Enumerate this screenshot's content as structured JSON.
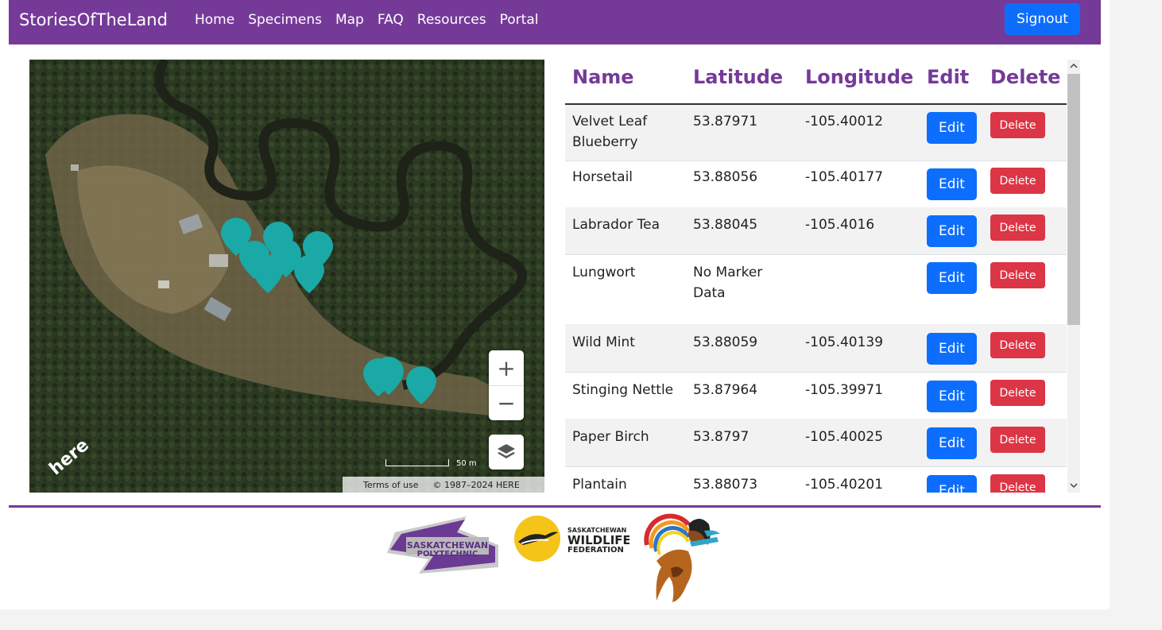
{
  "nav": {
    "brand": "StoriesOfTheLand",
    "links": [
      "Home",
      "Specimens",
      "Map",
      "FAQ",
      "Resources",
      "Portal"
    ],
    "signout": "Signout"
  },
  "map": {
    "terms": "Terms of use",
    "copyright": "© 1987–2024 HERE",
    "scale": "50 m",
    "logo_text": "here",
    "zoom_in": "+",
    "zoom_out": "−",
    "marker_color": "#1aa9a6"
  },
  "table": {
    "headers": [
      "Name",
      "Latitude",
      "Longitude",
      "Edit",
      "Delete"
    ],
    "edit_label": "Edit",
    "delete_label": "Delete",
    "rows": [
      {
        "name": "Velvet Leaf Blueberry",
        "lat": "53.87971",
        "lon": "-105.40012"
      },
      {
        "name": "Horsetail",
        "lat": "53.88056",
        "lon": "-105.40177"
      },
      {
        "name": "Labrador Tea",
        "lat": "53.88045",
        "lon": "-105.4016"
      },
      {
        "name": "Lungwort",
        "lat": "No Marker Data",
        "lon": ""
      },
      {
        "name": "Wild Mint",
        "lat": "53.88059",
        "lon": "-105.40139"
      },
      {
        "name": "Stinging Nettle",
        "lat": "53.87964",
        "lon": "-105.39971"
      },
      {
        "name": "Paper Birch",
        "lat": "53.8797",
        "lon": "-105.40025"
      },
      {
        "name": "Plantain",
        "lat": "53.88073",
        "lon": "-105.40201"
      }
    ]
  },
  "footer": {
    "logo1": {
      "line1": "SASKATCHEWAN",
      "line2": "POLYTECHNIC"
    },
    "logo2": {
      "line1": "SASKATCHEWAN",
      "line2": "WILDLIFE",
      "line3": "FEDERATION"
    }
  },
  "colors": {
    "brand_purple": "#753a98",
    "primary_blue": "#0d6efd",
    "danger_red": "#dc3545"
  }
}
